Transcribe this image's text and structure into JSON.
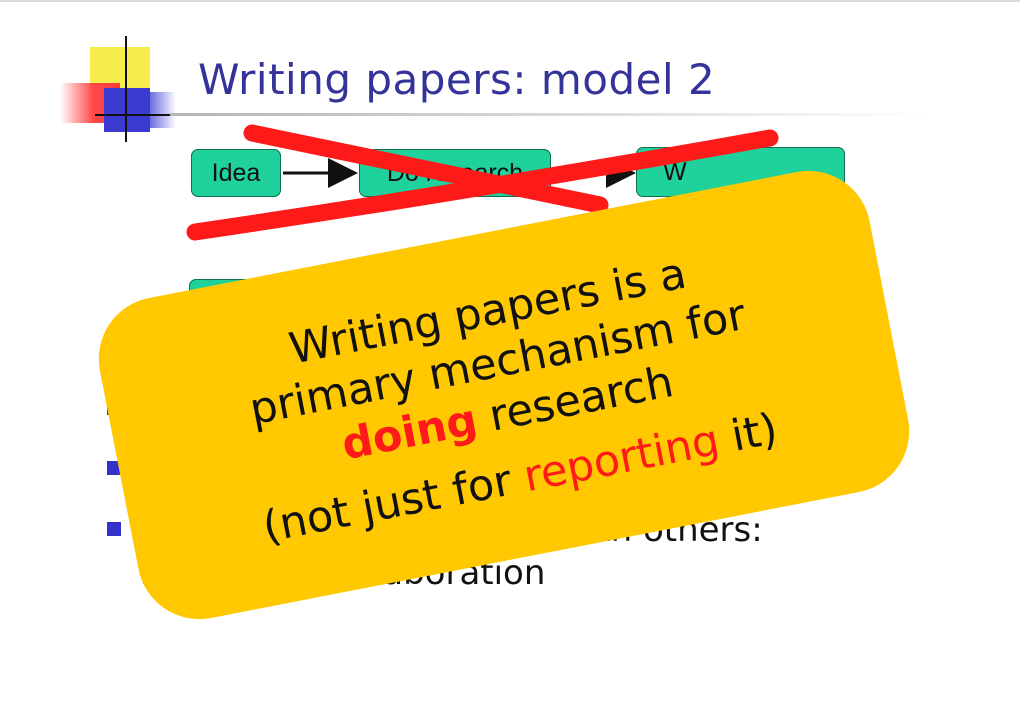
{
  "slide": {
    "title": "Writing papers: model 2"
  },
  "flow": {
    "idea": "Idea",
    "research": "Do research",
    "write": "W"
  },
  "bullets": {
    "line3_visible": "with others:",
    "line4_visible": "rique, and collaboration"
  },
  "overlay": {
    "line1": "Writing papers is a",
    "line2": "primary mechanism for",
    "line3_emph": "doing",
    "line3_rest": " research",
    "line4_pre": "(not just for ",
    "line4_emph": "reporting",
    "line4_post": " it)"
  },
  "colors": {
    "title": "#333399",
    "box_fill": "#1fd19a",
    "overlay": "#ffc800",
    "emphasis": "#ff1a1a",
    "cross": "#ff1a1a"
  }
}
